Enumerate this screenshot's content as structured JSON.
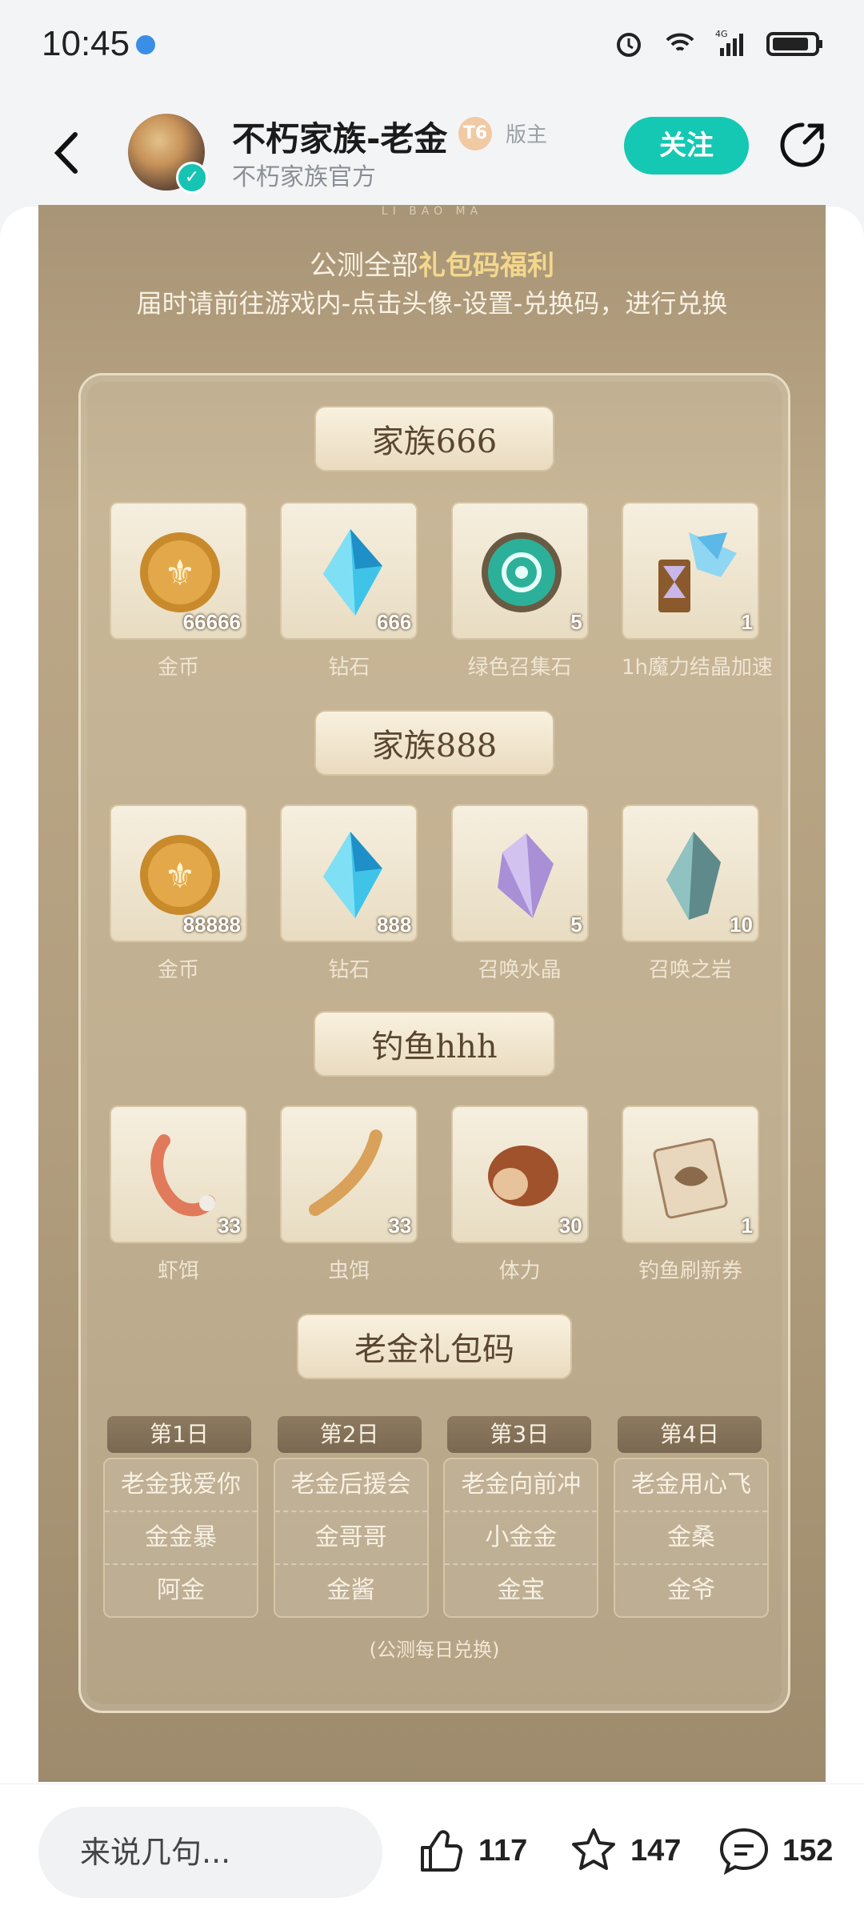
{
  "status_bar": {
    "time": "10:45",
    "network": "4G"
  },
  "header": {
    "author_name": "不朽家族-老金",
    "level_badge": "T6",
    "role": "版主",
    "author_sub": "不朽家族官方",
    "follow_label": "关注"
  },
  "poster": {
    "watermark": "LI BAO MA",
    "title_prefix": "公测全部",
    "title_highlight": "礼包码福利",
    "subtitle": "届时请前往游戏内-点击头像-设置-兑换码，进行兑换",
    "sections": [
      {
        "title": "家族666",
        "items": [
          {
            "label": "金币",
            "count": "66666",
            "icon": "gold-coin-icon"
          },
          {
            "label": "钻石",
            "count": "666",
            "icon": "diamond-icon"
          },
          {
            "label": "绿色召集石",
            "count": "5",
            "icon": "green-summon-stone-icon"
          },
          {
            "label": "1h魔力结晶加速",
            "count": "1",
            "icon": "hourglass-crystal-icon"
          }
        ]
      },
      {
        "title": "家族888",
        "items": [
          {
            "label": "金币",
            "count": "88888",
            "icon": "gold-coin-icon"
          },
          {
            "label": "钻石",
            "count": "888",
            "icon": "diamond-icon"
          },
          {
            "label": "召唤水晶",
            "count": "5",
            "icon": "summon-crystal-icon"
          },
          {
            "label": "召唤之岩",
            "count": "10",
            "icon": "summon-rock-icon"
          }
        ]
      },
      {
        "title": "钓鱼hhh",
        "items": [
          {
            "label": "虾饵",
            "count": "33",
            "icon": "shrimp-bait-icon"
          },
          {
            "label": "虫饵",
            "count": "33",
            "icon": "worm-bait-icon"
          },
          {
            "label": "体力",
            "count": "30",
            "icon": "bread-stamina-icon"
          },
          {
            "label": "钓鱼刷新券",
            "count": "1",
            "icon": "fishing-ticket-icon"
          }
        ]
      }
    ],
    "codes_title": "老金礼包码",
    "code_days": [
      {
        "day": "第1日",
        "codes": [
          "老金我爱你",
          "金金暴",
          "阿金"
        ]
      },
      {
        "day": "第2日",
        "codes": [
          "老金后援会",
          "金哥哥",
          "金酱"
        ]
      },
      {
        "day": "第3日",
        "codes": [
          "老金向前冲",
          "小金金",
          "金宝"
        ]
      },
      {
        "day": "第4日",
        "codes": [
          "老金用心飞",
          "金桑",
          "金爷"
        ]
      }
    ],
    "footer_note": "(公测每日兑换)"
  },
  "bottom_bar": {
    "comment_placeholder": "来说几句...",
    "like_count": "117",
    "favorite_count": "147",
    "comment_count": "152"
  },
  "colors": {
    "accent": "#15c8b3",
    "poster_bg": "#b09d7d",
    "highlight": "#f3d88c"
  }
}
